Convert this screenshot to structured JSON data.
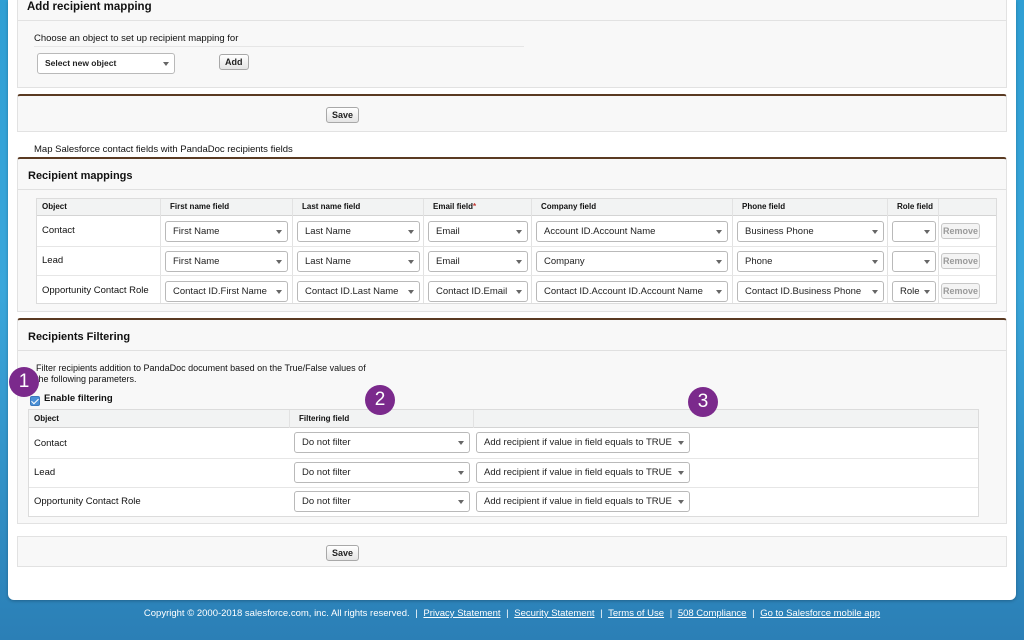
{
  "add_mapping": {
    "title": "Add recipient mapping",
    "choose_label": "Choose an object to set up recipient mapping for",
    "object_select_value": "Select new object",
    "add_button": "Add"
  },
  "save_label": "Save",
  "map_description": "Map Salesforce contact fields with PandaDoc recipients fields",
  "recipient_mappings": {
    "title": "Recipient mappings",
    "columns": [
      "Object",
      "First name field",
      "Last name field",
      "Email field",
      "Company field",
      "Phone field",
      "Role field"
    ],
    "required_marker": "*",
    "remove_label": "Remove",
    "rows": [
      {
        "object": "Contact",
        "first": "First Name",
        "last": "Last Name",
        "email": "Email",
        "company": "Account ID.Account Name",
        "phone": "Business Phone",
        "role": ""
      },
      {
        "object": "Lead",
        "first": "First Name",
        "last": "Last Name",
        "email": "Email",
        "company": "Company",
        "phone": "Phone",
        "role": ""
      },
      {
        "object": "Opportunity Contact Role",
        "first": "Contact ID.First Name",
        "last": "Contact ID.Last Name",
        "email": "Contact ID.Email",
        "company": "Contact ID.Account ID.Account Name",
        "phone": "Contact ID.Business Phone",
        "role": "Role"
      }
    ]
  },
  "recipients_filtering": {
    "title": "Recipients Filtering",
    "description_line1": "Filter recipients addition to PandaDoc document based on the True/False values of",
    "description_line2": "the following parameters.",
    "enable_label": "Enable filtering",
    "enable_checked": true,
    "columns": [
      "Object",
      "Filtering field",
      ""
    ],
    "rows": [
      {
        "object": "Contact",
        "filter": "Do not filter",
        "rule": "Add recipient if value in field equals to TRUE"
      },
      {
        "object": "Lead",
        "filter": "Do not filter",
        "rule": "Add recipient if value in field equals to TRUE"
      },
      {
        "object": "Opportunity Contact Role",
        "filter": "Do not filter",
        "rule": "Add recipient if value in field equals to TRUE"
      }
    ]
  },
  "badges": [
    "1",
    "2",
    "3"
  ],
  "badge_color": "#7b2a8c",
  "section_border_color": "#5a3a22",
  "footer": {
    "copyright": "Copyright © 2000-2018 salesforce.com, inc. All rights reserved.",
    "separator": "|",
    "links": [
      "Privacy Statement",
      "Security Statement",
      "Terms of Use",
      "508 Compliance",
      "Go to Salesforce mobile app"
    ]
  }
}
